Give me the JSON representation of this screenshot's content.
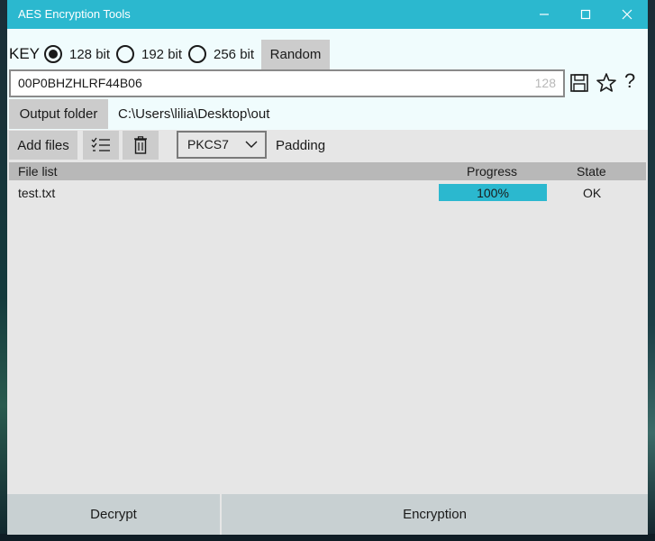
{
  "window": {
    "title": "AES Encryption Tools"
  },
  "key": {
    "label": "KEY",
    "options": [
      {
        "label": "128 bit",
        "selected": true
      },
      {
        "label": "192 bit",
        "selected": false
      },
      {
        "label": "256 bit",
        "selected": false
      }
    ],
    "random_label": "Random",
    "value": "00P0BHZHLRF44B06",
    "length_hint": "128"
  },
  "output": {
    "button_label": "Output folder",
    "path": "C:\\Users\\lilia\\Desktop\\out"
  },
  "toolbar": {
    "add_files_label": "Add files",
    "padding_value": "PKCS7",
    "padding_label": "Padding"
  },
  "file_list": {
    "columns": [
      "File list",
      "Progress",
      "State"
    ],
    "rows": [
      {
        "name": "test.txt",
        "progress_text": "100%",
        "progress": 1.0,
        "state": "OK"
      }
    ]
  },
  "actions": {
    "decrypt_label": "Decrypt",
    "encrypt_label": "Encryption"
  },
  "colors": {
    "accent": "#2bb8cf",
    "button_bg": "#cccccc",
    "header_bg": "#b8b8b8"
  },
  "icons": {
    "save": "floppy-disk-icon",
    "favorite": "star-icon",
    "help": "question-icon",
    "checklist": "checklist-icon",
    "delete": "trash-icon"
  }
}
